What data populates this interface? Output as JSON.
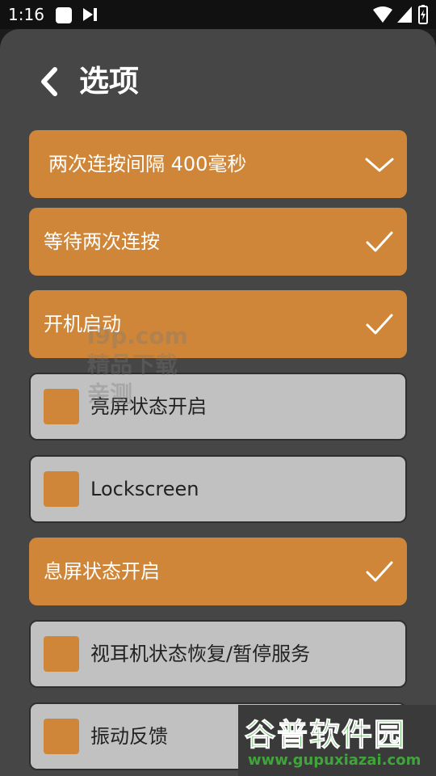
{
  "status_bar": {
    "time": "1:16"
  },
  "header": {
    "title": "选项"
  },
  "options": [
    {
      "label": "两次连按间隔 400毫秒",
      "checked": true,
      "control": "chevron-down-icon"
    },
    {
      "label": "等待两次连按",
      "checked": true,
      "control": "checkmark-icon"
    },
    {
      "label": "开机启动",
      "checked": true,
      "control": "checkmark-icon"
    },
    {
      "label": "亮屏状态开启",
      "checked": false,
      "control": "checkbox"
    },
    {
      "label": "Lockscreen",
      "checked": false,
      "control": "checkbox"
    },
    {
      "label": "息屏状态开启",
      "checked": true,
      "control": "checkmark-icon"
    },
    {
      "label": "视耳机状态恢复/暂停服务",
      "checked": false,
      "control": "checkbox"
    },
    {
      "label": "振动反馈",
      "checked": false,
      "control": "checkbox"
    }
  ],
  "watermark": {
    "line1": "i9p.com",
    "line2": "精品下载",
    "line3": "亲测"
  },
  "logo": {
    "title": "谷普软件园",
    "url": "www.gupuxiazai.com"
  },
  "colors": {
    "accent": "#cf8638",
    "panel": "#464646",
    "off_item": "#c1c1c1"
  }
}
